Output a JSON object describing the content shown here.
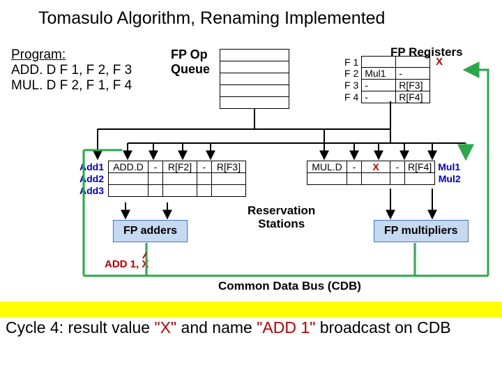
{
  "title": "Tomasulo Algorithm, Renaming Implemented",
  "program": {
    "heading": "Program:",
    "lines": [
      "ADD. D  F 1, F 2, F 3",
      "MUL. D  F 2, F 1, F 4"
    ]
  },
  "fp_op_queue": {
    "label_l1": "FP Op",
    "label_l2": "Queue"
  },
  "fp_registers": {
    "label": "FP Registers",
    "result_value": "X",
    "rows": [
      {
        "name": "F 1",
        "tag": "",
        "val": ""
      },
      {
        "name": "F 2",
        "tag": "Mul1",
        "val": "-"
      },
      {
        "name": "F 3",
        "tag": "-",
        "val": "R[F3]"
      },
      {
        "name": "F 4",
        "tag": "-",
        "val": "R[F4]"
      }
    ]
  },
  "rs_add": {
    "labels": [
      "Add1",
      "Add2",
      "Add3"
    ],
    "rows": [
      {
        "op": "ADD.D",
        "t1": "-",
        "v1": "R[F2]",
        "t2": "-",
        "v2": "R[F3]"
      },
      {
        "op": "",
        "t1": "",
        "v1": "",
        "t2": "",
        "v2": ""
      },
      {
        "op": "",
        "t1": "",
        "v1": "",
        "t2": "",
        "v2": ""
      }
    ]
  },
  "rs_mul": {
    "labels": [
      "Mul1",
      "Mul2"
    ],
    "rows": [
      {
        "op": "MUL.D",
        "t1": "-",
        "v1": "X",
        "t2": "-",
        "v2": "R[F4]"
      },
      {
        "op": "",
        "t1": "",
        "v1": "",
        "t2": "",
        "v2": ""
      }
    ]
  },
  "fu": {
    "adders": "FP adders",
    "multipliers": "FP multipliers"
  },
  "rs_label": {
    "l1": "Reservation",
    "l2": "Stations"
  },
  "broadcast": "ADD 1, X",
  "cdb_label": "Common Data Bus (CDB)",
  "caption": {
    "p1": "Cycle 4: result value ",
    "p2": "\"X\"",
    "p3": " and name ",
    "p4": "\"ADD 1\"",
    "p5": " broadcast on CDB"
  }
}
